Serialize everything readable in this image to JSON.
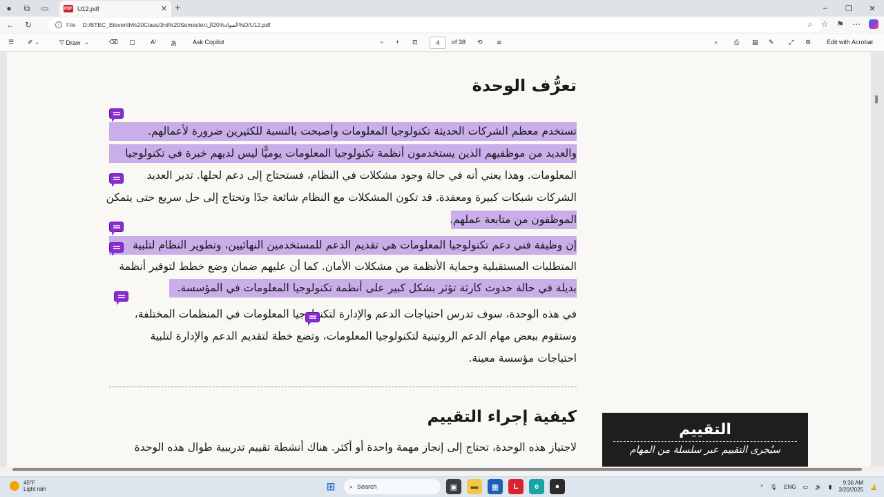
{
  "browser": {
    "tab_title": "U12.pdf",
    "url_scheme_label": "File",
    "url": "D:/BTEC_Eleventh%20Class/3rd%20Semester/المواد%20ال%D/U12.pdf",
    "new_tab_symbol": "+",
    "window_controls": [
      "–",
      "❐",
      "✕"
    ]
  },
  "pdf_toolbar": {
    "draw_label": "Draw",
    "ask_copilot_label": "Ask Copilot",
    "page_current": "4",
    "page_total": "of 38",
    "edit_with_acrobat_label": "Edit with Acrobat"
  },
  "document": {
    "heading_1": "تعرُّف الوحدة",
    "para1": [
      "تستخدم معظم الشركات الحديثة تكنولوجيا المعلومات وأصبحت بالنسبة للكثيرين ضرورة لأعمالهم.",
      "والعديد من موظفيهم الذين يستخدمون أنظمة تكنولوجيا المعلومات يوميًّا ليس لديهم خبرة في تكنولوجيا",
      "المعلومات. وهذا يعني أنه في حالة وجود مشكلات في النظام، فستحتاج إلى دعم لحلها. تدير العديد",
      "الشركات شبكات كبيرة ومعقدة. قد تكون المشكلات مع النظام شائعة جدًا وتحتاج إلى حل سريع حتى يتمكن",
      "الموظفون من متابعة عملهم."
    ],
    "para2": [
      "إن وظيفة فني دعم تكنولوجيا المعلومات هي تقديم الدعم للمستخدمين النهائيين، وتطوير النظام لتلبية",
      "المتطلبات المستقبلية وحماية الأنظمة من مشكلات الأمان. كما أن عليهم ضمان وضع خطط لتوفير أنظمة",
      "بديلة في حالة حدوث كارثة تؤثر بشكل كبير على أنظمة تكنولوجيا المعلومات في المؤسسة."
    ],
    "para3": [
      "في هذه الوحدة، سوف تدرس احتياجات الدعم والإدارة لتكنولوجيا المعلومات في المنظمات المختلفة،",
      "وستقوم ببعض مهام الدعم الروتينية لتكنولوجيا المعلومات، وتضع خطة لتقديم الدعم والإدارة لتلبية",
      "احتياجات مؤسسة معينة."
    ],
    "heading_2": "كيفية إجراء التقييم",
    "para4_line1": "لاجتياز هذه الوحدة، تحتاج إلى إنجاز مهمة واحدة أو أكثر. هناك أنشطة تقييم تدريبية طوال هذه الوحدة",
    "assessment_box": {
      "title": "التقييم",
      "subtitle": "سيُجرى التقييم عبر سلسلة من المهام"
    },
    "highlight_color": "#c9aeea",
    "comment_color": "#8a2bd6"
  },
  "taskbar": {
    "temperature": "45°F",
    "weather_text": "Light rain",
    "search_label": "Search",
    "language": "ENG",
    "time": "9:36 AM",
    "date": "3/20/2025"
  }
}
